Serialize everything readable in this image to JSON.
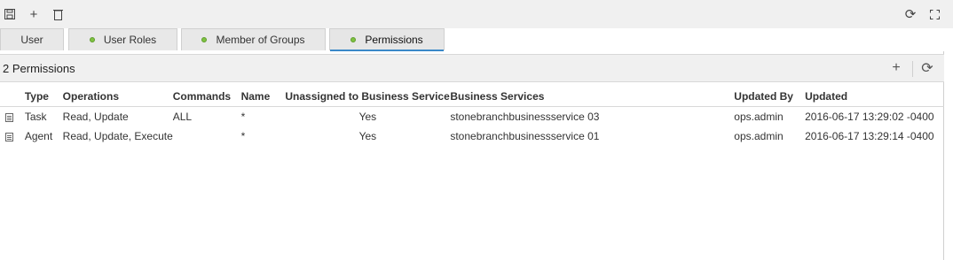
{
  "toolbar": {
    "icons": [
      "save-icon",
      "add-icon",
      "delete-icon",
      "refresh-icon",
      "fullscreen-icon"
    ],
    "save_glyph": "🖫",
    "add_glyph": "+",
    "delete_glyph": "🗑",
    "refresh_glyph": "⟳",
    "fullscreen_glyph": "⛶"
  },
  "tabs": [
    {
      "label": "User",
      "status_dot": false
    },
    {
      "label": "User Roles",
      "status_dot": true
    },
    {
      "label": "Member of Groups",
      "status_dot": true
    },
    {
      "label": "Permissions",
      "status_dot": true,
      "active": true
    }
  ],
  "panel": {
    "title": "2 Permissions",
    "add_glyph": "+",
    "refresh_glyph": "⟳"
  },
  "table": {
    "columns": [
      "Type",
      "Operations",
      "Commands",
      "Name",
      "Unassigned to Business Service",
      "Business Services",
      "Updated By",
      "Updated"
    ],
    "rows": [
      {
        "type": "Task",
        "operations": "Read, Update",
        "commands": "ALL",
        "name": "*",
        "unassigned": "Yes",
        "business_services": "stonebranchbusinessservice 03",
        "updated_by": "ops.admin",
        "updated": "2016-06-17 13:29:02 -0400"
      },
      {
        "type": "Agent",
        "operations": "Read, Update, Execute",
        "commands": "",
        "name": "*",
        "unassigned": "Yes",
        "business_services": "stonebranchbusinessservice 01",
        "updated_by": "ops.admin",
        "updated": "2016-06-17 13:29:14 -0400"
      }
    ]
  },
  "colors": {
    "status_dot": "#7fc241",
    "active_tab_underline": "#3a88c8"
  }
}
